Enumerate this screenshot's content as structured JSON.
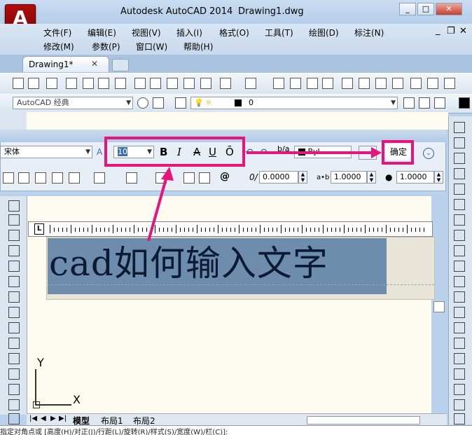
{
  "app": {
    "title": "Autodesk AutoCAD 2014",
    "document": "Drawing1.dwg",
    "logo_letter": "A",
    "window_controls": [
      "_",
      "□",
      "✕"
    ]
  },
  "menu": {
    "row1": [
      "文件(F)",
      "编辑(E)",
      "视图(V)",
      "插入(I)",
      "格式(O)",
      "工具(T)",
      "绘图(D)",
      "标注(N)"
    ],
    "row2": [
      "修改(M)",
      "参数(P)",
      "窗口(W)",
      "帮助(H)"
    ],
    "doc_controls": [
      "_",
      "❐",
      "✕"
    ]
  },
  "tabs": [
    {
      "label": "Drawing1*",
      "close": "✕"
    }
  ],
  "toolbar2": {
    "workspace": "AutoCAD 经典",
    "layer_value": "0"
  },
  "text_format": {
    "font": "宋体",
    "height": "10",
    "bold": "B",
    "italic": "I",
    "strike": "A",
    "underline": "U",
    "overline": "Ō",
    "color": "ByL",
    "ok_label": "确定",
    "oblique": "0.0000",
    "tracking": "1.0000",
    "width_factor": "1.0000",
    "at_symbol": "@",
    "oblique_symbol": "0/",
    "tracking_symbol": "a•b"
  },
  "canvas": {
    "text": "cad如何输入文字",
    "axis_y": "Y",
    "axis_x": "X"
  },
  "layout_tabs": [
    "模型",
    "布局1",
    "布局2"
  ],
  "command_line": "指定对角点或 [高度(H)/对正(J)/行距(L)/旋转(R)/样式(S)/宽度(W)/栏(C)]:",
  "colors": {
    "highlight": "#e5157a",
    "selection": "#6e8cac",
    "canvas": "#fdfaf0"
  }
}
